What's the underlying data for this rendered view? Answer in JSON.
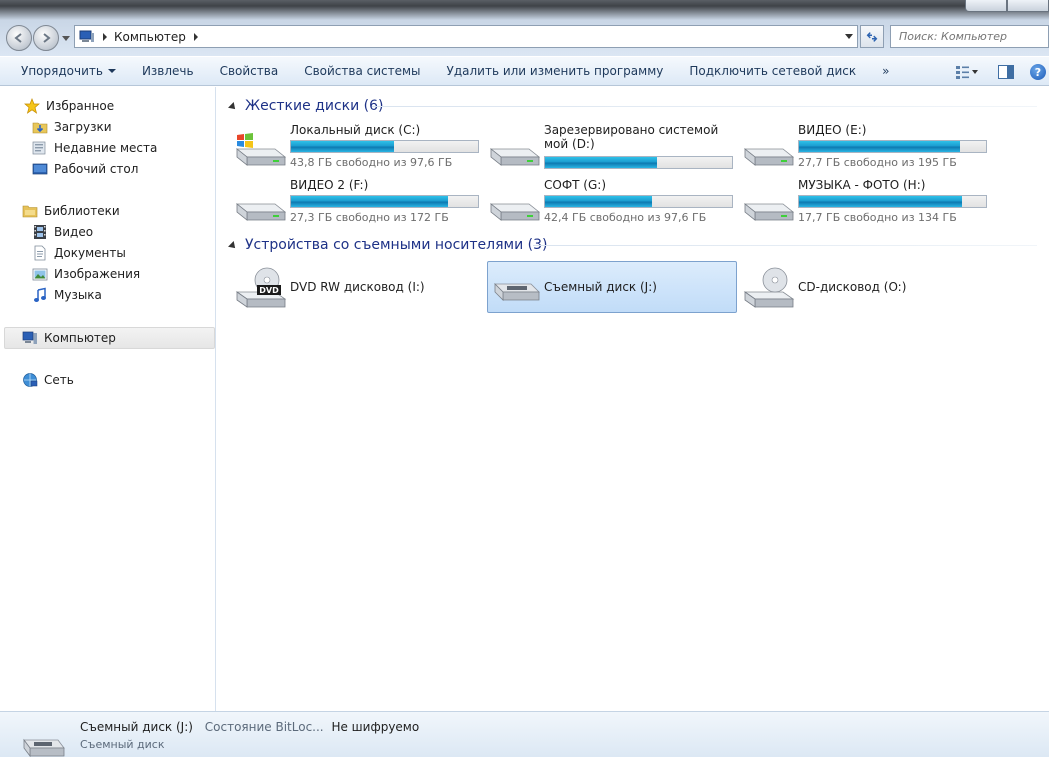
{
  "window": {
    "address": {
      "crumbs": [
        "Компьютер"
      ]
    },
    "search": {
      "placeholder": "Поиск: Компьютер"
    }
  },
  "toolbar": {
    "items": [
      {
        "label": "Упорядочить",
        "dropdown": true
      },
      {
        "label": "Извлечь"
      },
      {
        "label": "Свойства"
      },
      {
        "label": "Свойства системы"
      },
      {
        "label": "Удалить или изменить программу"
      },
      {
        "label": "Подключить сетевой диск"
      },
      {
        "label": "»"
      }
    ]
  },
  "sidebar": {
    "favorites": {
      "label": "Избранное",
      "items": [
        "Загрузки",
        "Недавние места",
        "Рабочий стол"
      ]
    },
    "libraries": {
      "label": "Библиотеки",
      "items": [
        "Видео",
        "Документы",
        "Изображения",
        "Музыка"
      ]
    },
    "computer": {
      "label": "Компьютер"
    },
    "network": {
      "label": "Сеть"
    }
  },
  "groups": {
    "hard_disks": {
      "title": "Жесткие диски (6)",
      "drives": [
        {
          "name": "Локальный диск (C:)",
          "free": "43,8 ГБ свободно из 97,6 ГБ",
          "used_fraction": 0.55,
          "icon": "windows-drive-icon"
        },
        {
          "name": "Зарезервировано системой мой (D:)",
          "free": "",
          "used_fraction": 0.6,
          "icon": "hard-drive-icon"
        },
        {
          "name": "ВИДЕО (E:)",
          "free": "27,7 ГБ свободно из 195 ГБ",
          "used_fraction": 0.86,
          "icon": "hard-drive-icon"
        },
        {
          "name": "ВИДЕО 2 (F:)",
          "free": "27,3 ГБ свободно из 172 ГБ",
          "used_fraction": 0.84,
          "icon": "hard-drive-icon"
        },
        {
          "name": "СОФТ (G:)",
          "free": "42,4 ГБ свободно из 97,6 ГБ",
          "used_fraction": 0.57,
          "icon": "hard-drive-icon"
        },
        {
          "name": "МУЗЫКА -  ФОТО (H:)",
          "free": "17,7 ГБ свободно из 134 ГБ",
          "used_fraction": 0.87,
          "icon": "hard-drive-icon"
        }
      ]
    },
    "removable": {
      "title": "Устройства со съемными носителями (3)",
      "drives": [
        {
          "name": "DVD RW дисковод (I:)",
          "icon": "dvd-drive-icon"
        },
        {
          "name": "Съемный диск (J:)",
          "icon": "removable-drive-icon",
          "selected": true
        },
        {
          "name": "CD-дисковод (O:)",
          "icon": "cd-drive-icon"
        }
      ]
    }
  },
  "details": {
    "name": "Съемный диск (J:)",
    "bitlocker_label": "Состояние BitLoc...",
    "bitlocker_value": "Не шифруемо",
    "type": "Съемный диск"
  },
  "colors": {
    "bar_fill": "#1c9cd0",
    "group_header": "#1e3287",
    "selection": "#c1dcf8"
  }
}
